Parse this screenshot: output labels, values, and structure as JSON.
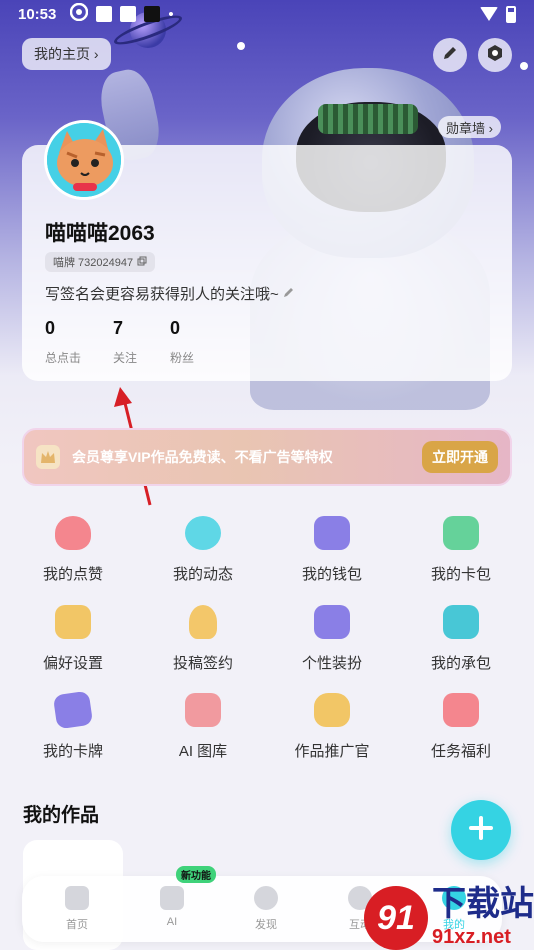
{
  "status_bar": {
    "time": "10:53"
  },
  "header": {
    "home_label": "我的主页 ›",
    "badge_wall": "勋章墙 ›"
  },
  "profile": {
    "username": "喵喵喵2063",
    "user_id": "喵牌 732024947",
    "signature": "写签名会更容易获得别人的关注哦~",
    "stats": [
      {
        "value": "0",
        "label": "总点击"
      },
      {
        "value": "7",
        "label": "关注"
      },
      {
        "value": "0",
        "label": "粉丝"
      }
    ]
  },
  "vip": {
    "text": "会员尊享VIP作品免费读、不看广告等特权",
    "button": "立即开通"
  },
  "grid": [
    {
      "label": "我的点赞",
      "icon": "heart-icon",
      "color": "#f4868e"
    },
    {
      "label": "我的动态",
      "icon": "leaf-icon",
      "color": "#5fd7e6"
    },
    {
      "label": "我的钱包",
      "icon": "wallet-icon",
      "color": "#8a7fe6"
    },
    {
      "label": "我的卡包",
      "icon": "card-icon",
      "color": "#65d29a"
    },
    {
      "label": "偏好设置",
      "icon": "heart-tag-icon",
      "color": "#f2c666"
    },
    {
      "label": "投稿签约",
      "icon": "bulb-icon",
      "color": "#f3c76a"
    },
    {
      "label": "个性装扮",
      "icon": "shop-icon",
      "color": "#8a7fe6"
    },
    {
      "label": "我的承包",
      "icon": "fish-icon",
      "color": "#48c7d6"
    },
    {
      "label": "我的卡牌",
      "icon": "cards-icon",
      "color": "#8a7fe6"
    },
    {
      "label": "AI 图库",
      "icon": "image-icon",
      "color": "#f19a9f"
    },
    {
      "label": "作品推广官",
      "icon": "money-bag-icon",
      "color": "#f2c666"
    },
    {
      "label": "任务福利",
      "icon": "gift-bag-icon",
      "color": "#f4868e"
    }
  ],
  "works": {
    "title": "我的作品"
  },
  "tabbar": {
    "new_tag": "新功能",
    "tabs": [
      {
        "label": "首页",
        "icon": "home-icon"
      },
      {
        "label": "AI",
        "icon": "ai-icon"
      },
      {
        "label": "发现",
        "icon": "discover-icon"
      },
      {
        "label": "互动",
        "icon": "message-icon"
      },
      {
        "label": "我的",
        "icon": "profile-icon"
      }
    ]
  },
  "watermark": {
    "logo": "91",
    "top": "下载站",
    "bottom": "91xz.net"
  }
}
